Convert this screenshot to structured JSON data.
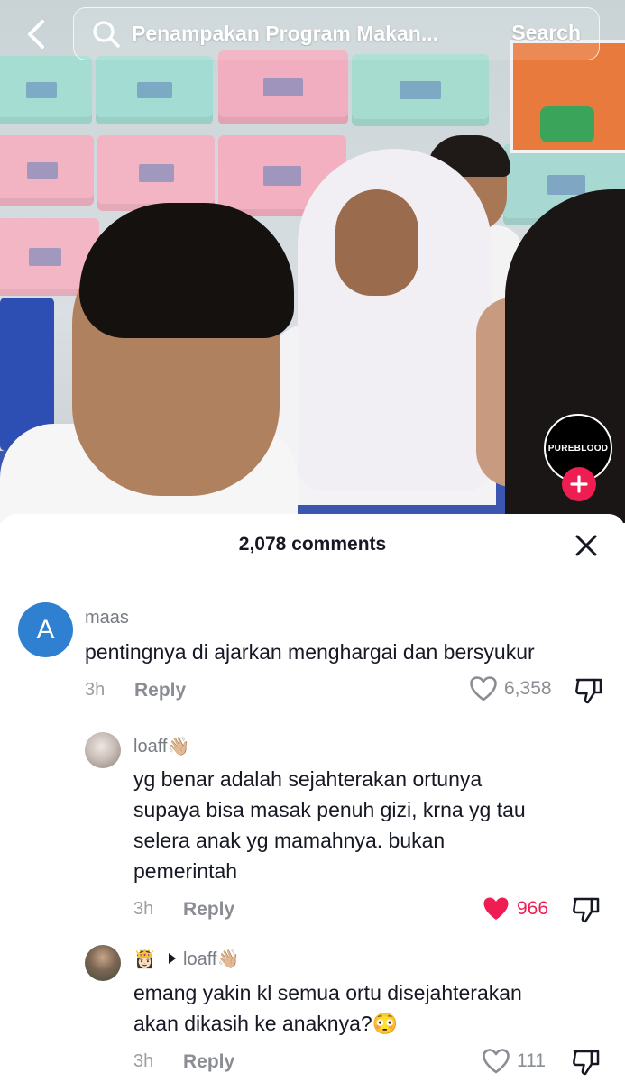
{
  "search": {
    "query": "Penampakan Program Makan...",
    "button_label": "Search"
  },
  "creator": {
    "name": "PUREBLOOD"
  },
  "comments_panel": {
    "title": "2,078 comments",
    "comments": [
      {
        "avatar_letter": "A",
        "username": "maas",
        "text": "pentingnya di ajarkan menghargai dan bersyukur",
        "time": "3h",
        "reply_label": "Reply",
        "likes": "6,358"
      },
      {
        "username": "loaff👋🏼",
        "text_lines": [
          "yg benar adalah sejahterakan ortunya",
          "supaya bisa masak penuh gizi, krna yg tau",
          "selera anak yg mamahnya. bukan",
          "pemerintah"
        ],
        "time": "3h",
        "reply_label": "Reply",
        "likes": "966"
      },
      {
        "username_prefix": "👸🏻",
        "reply_to": "loaff👋🏼",
        "text_lines": [
          "emang yakin kl semua ortu disejahterakan",
          "akan dikasih ke anaknya?😳"
        ],
        "time": "3h",
        "reply_label": "Reply",
        "likes": "111"
      }
    ]
  },
  "colors": {
    "accent": "#ee1d52",
    "avatar_blue": "#2f80d0",
    "text_primary": "#161823",
    "text_secondary": "#8a8d93"
  }
}
